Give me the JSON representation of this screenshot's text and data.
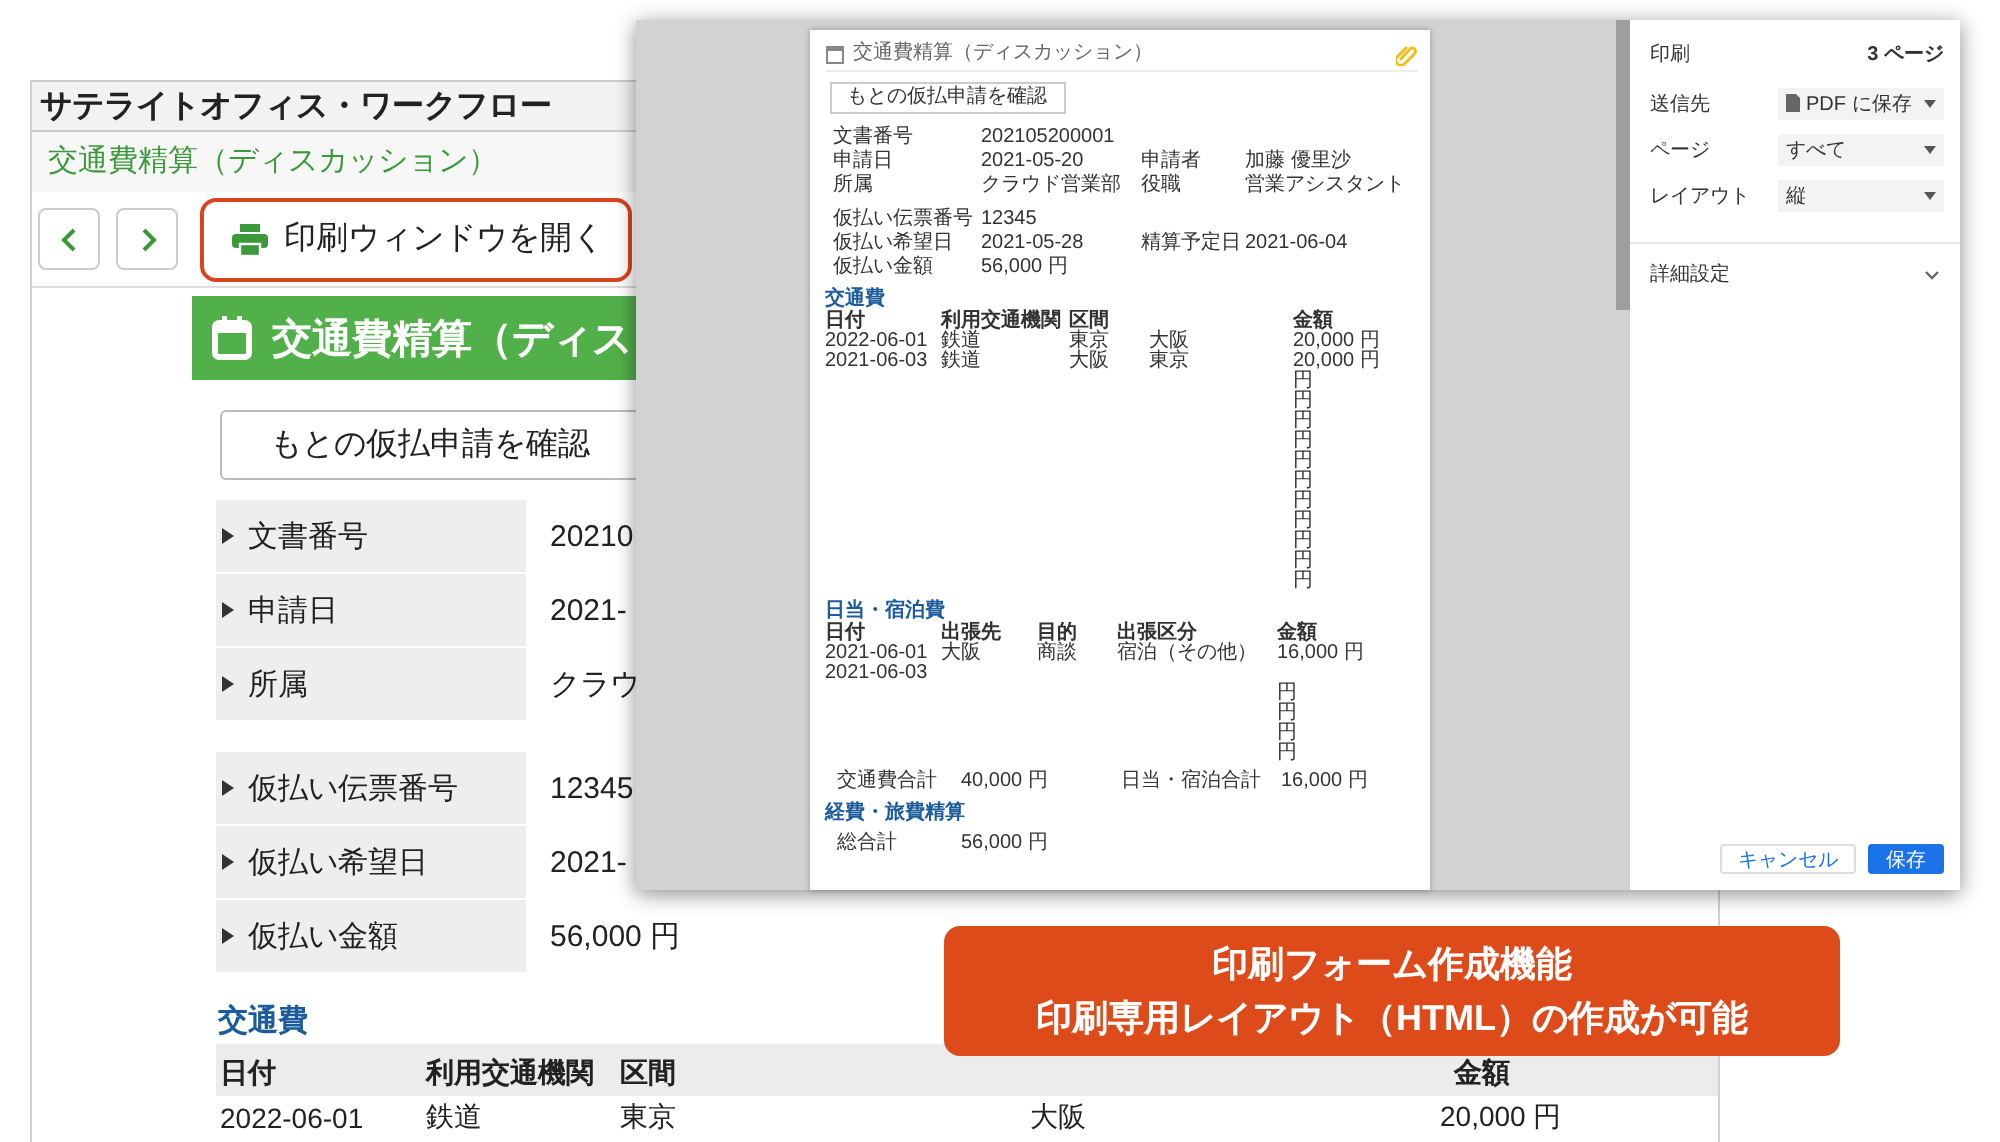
{
  "app": {
    "title": "サテライトオフィス・ワークフロー",
    "breadcrumb": "交通費精算（ディスカッション）",
    "print_button": {
      "label": "印刷ウィンドウを開く",
      "highlighted": true
    }
  },
  "form": {
    "header": "交通費精算（ディス",
    "original_button": "もとの仮払申請を確認",
    "field_groups": [
      [
        {
          "label": "文書番号",
          "value": "20210"
        },
        {
          "label": "申請日",
          "value": "2021-"
        },
        {
          "label": "所属",
          "value": "クラウ"
        }
      ],
      [
        {
          "label": "仮払い伝票番号",
          "value": "12345"
        },
        {
          "label": "仮払い希望日",
          "value": "2021-"
        },
        {
          "label": "仮払い金額",
          "value": "56,000 円"
        }
      ]
    ],
    "transport": {
      "heading": "交通費",
      "columns": [
        "日付",
        "利用交通機関",
        "区間",
        "金額"
      ],
      "rows": [
        {
          "date": "2022-06-01",
          "means": "鉄道",
          "from": "東京",
          "to": "大阪",
          "amount": "20,000 円"
        }
      ]
    }
  },
  "print_dialog": {
    "preview": {
      "title": "交通費精算（ディスカッション）",
      "original_button": "もとの仮払申請を確認",
      "field_groups": [
        [
          [
            {
              "label": "文書番号",
              "value": "202105200001"
            }
          ],
          [
            {
              "label": "申請日",
              "value": "2021-05-20"
            },
            {
              "label": "申請者",
              "value": "加藤 優里沙"
            }
          ],
          [
            {
              "label": "所属",
              "value": "クラウド営業部"
            },
            {
              "label": "役職",
              "value": "営業アシスタント"
            }
          ]
        ],
        [
          [
            {
              "label": "仮払い伝票番号",
              "value": "12345"
            }
          ],
          [
            {
              "label": "仮払い希望日",
              "value": "2021-05-28"
            },
            {
              "label": "精算予定日",
              "value": "2021-06-04"
            }
          ],
          [
            {
              "label": "仮払い金額",
              "value": "56,000 円"
            }
          ]
        ]
      ],
      "transport": {
        "heading": "交通費",
        "columns": [
          "日付",
          "利用交通機関",
          "区間",
          "金額"
        ],
        "rows": [
          {
            "date": "2022-06-01",
            "means": "鉄道",
            "from": "東京",
            "to": "大阪",
            "amount": "20,000 円"
          },
          {
            "date": "2021-06-03",
            "means": "鉄道",
            "from": "大阪",
            "to": "東京",
            "amount": "20,000 円"
          },
          {
            "amount": "円"
          },
          {
            "amount": "円"
          },
          {
            "amount": "円"
          },
          {
            "amount": "円"
          },
          {
            "amount": "円"
          },
          {
            "amount": "円"
          },
          {
            "amount": "円"
          },
          {
            "amount": "円"
          },
          {
            "amount": "円"
          },
          {
            "amount": "円"
          },
          {
            "amount": "円"
          }
        ]
      },
      "allowance": {
        "heading": "日当・宿泊費",
        "columns": [
          "日付",
          "出張先",
          "目的",
          "出張区分",
          "金額"
        ],
        "rows": [
          {
            "date": "2021-06-01",
            "place": "大阪",
            "purpose": "商談",
            "category": "宿泊（その他）",
            "amount": "16,000 円"
          },
          {
            "date": "2021-06-03"
          },
          {
            "amount": "円"
          },
          {
            "amount": "円"
          },
          {
            "amount": "円"
          },
          {
            "amount": "円"
          }
        ]
      },
      "totals": [
        {
          "label": "交通費合計",
          "value": "40,000 円"
        },
        {
          "label": "日当・宿泊合計",
          "value": "16,000 円"
        }
      ],
      "summary": {
        "heading": "経費・旅費精算",
        "label": "総合計",
        "value": "56,000 円"
      }
    },
    "settings": {
      "title": "印刷",
      "page_count": "3 ページ",
      "options": [
        {
          "label": "送信先",
          "value": "PDF に保存",
          "kind": "file"
        },
        {
          "label": "ページ",
          "value": "すべて",
          "kind": "plain"
        },
        {
          "label": "レイアウト",
          "value": "縦",
          "kind": "plain"
        }
      ],
      "more": "詳細設定",
      "cancel": "キャンセル",
      "save": "保存"
    }
  },
  "banner": {
    "lines": [
      "印刷フォーム作成機能",
      "印刷専用レイアウト（HTML）の作成が可能"
    ]
  }
}
